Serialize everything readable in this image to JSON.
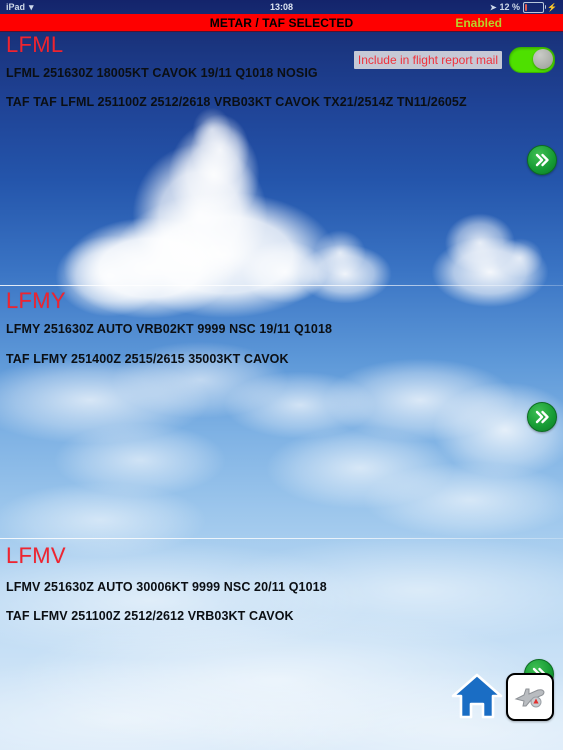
{
  "status_bar": {
    "device": "iPad",
    "wifi_icon": "wifi-icon",
    "time": "13:08",
    "location_icon": "location-arrow-icon",
    "battery_percent": "12 %",
    "battery_level": 12,
    "charging_icon": "lightning-bolt-icon"
  },
  "title_bar": {
    "title": "METAR / TAF SELECTED",
    "status": "Enabled",
    "background_color": "#fe0000",
    "status_color": "#b9d02a"
  },
  "toggle": {
    "label": "Include in flight report mail",
    "state": "on",
    "on_color": "#4ee000",
    "label_color": "#f0323c"
  },
  "stations": [
    {
      "code": "LFML",
      "metar": "LFML 251630Z 18005KT CAVOK 19/11 Q1018 NOSIG",
      "taf": "TAF TAF LFML 251100Z 2512/2618 VRB03KT CAVOK TX21/2514Z TN11/2605Z",
      "expand_icon": "double-chevron-right-icon"
    },
    {
      "code": "LFMY",
      "metar": "LFMY 251630Z AUTO VRB02KT 9999 NSC 19/11 Q1018",
      "taf": "TAF LFMY 251400Z 2515/2615 35003KT CAVOK",
      "expand_icon": "double-chevron-right-icon"
    },
    {
      "code": "LFMV",
      "metar": "LFMV 251630Z AUTO 30006KT 9999 NSC 20/11 Q1018",
      "taf": "TAF LFMV 251100Z 2512/2612 VRB03KT CAVOK",
      "expand_icon": "double-chevron-right-icon"
    }
  ],
  "toolbar": {
    "home_icon": "home-icon",
    "flight_plan_icon": "airplane-icon",
    "expand_icon": "double-chevron-right-icon"
  },
  "theme": {
    "station_code_color": "#ef2430",
    "report_text_color": "#0b0f14"
  }
}
